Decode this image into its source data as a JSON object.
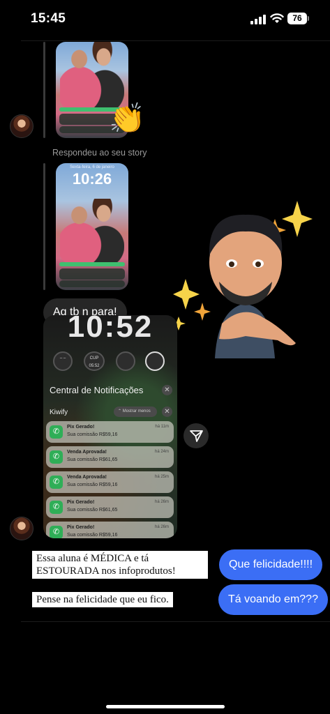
{
  "status_bar": {
    "time": "15:45",
    "battery": "76"
  },
  "stories": [
    {
      "clock": "",
      "date": ""
    },
    {
      "clock": "10:26",
      "date": "Sexta-feira, 6 de janeiro"
    }
  ],
  "replied_label": "Respondeu ao seu story",
  "messages_in": [
    "Aq tb n para!"
  ],
  "screenshot": {
    "clock": "10:52",
    "widget_cup": "CUP",
    "widget_time": "05:52",
    "title": "Central de Notificações",
    "app": "Kiwify",
    "show_less": "Mostrar menos",
    "notifications": [
      {
        "title": "Pix Gerado!",
        "body": "Sua comissão R$59,16",
        "time": "há 11m"
      },
      {
        "title": "Venda Aprovada!",
        "body": "Sua comissão R$61,65",
        "time": "há 24m"
      },
      {
        "title": "Venda Aprovada!",
        "body": "Sua comissão R$59,16",
        "time": "há 25m"
      },
      {
        "title": "Pix Gerado!",
        "body": "Sua comissão R$61,65",
        "time": "há 26m"
      },
      {
        "title": "Pix Gerado!",
        "body": "Sua comissão R$59,16",
        "time": "há 26m"
      }
    ]
  },
  "captions": [
    "Essa aluna é MÉDICA e tá ESTOURADA nos infoprodutos!",
    "Pense na felicidade que eu fico."
  ],
  "messages_out": [
    "Que felicidade!!!!",
    "Tá voando em???"
  ],
  "icons": {
    "clap": "clapping-hands",
    "share": "paper-plane",
    "sticker": "memoji-sparkles"
  }
}
